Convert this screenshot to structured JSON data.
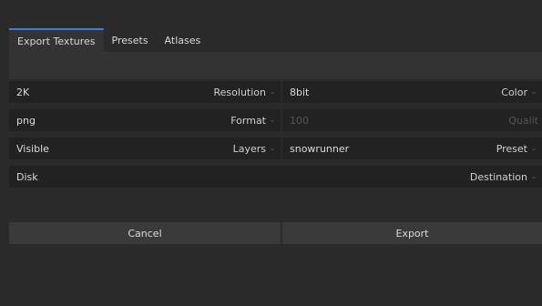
{
  "tabs": [
    {
      "label": "Export Textures",
      "active": true
    },
    {
      "label": "Presets",
      "active": false
    },
    {
      "label": "Atlases",
      "active": false
    }
  ],
  "settings": {
    "resolution": {
      "value": "2K",
      "label": "Resolution"
    },
    "color": {
      "value": "8bit",
      "label": "Color"
    },
    "format": {
      "value": "png",
      "label": "Format"
    },
    "quality": {
      "value": "100",
      "label": "Qualit",
      "disabled": true
    },
    "layers": {
      "value": "Visible",
      "label": "Layers"
    },
    "preset": {
      "value": "snowrunner",
      "label": "Preset"
    },
    "destination": {
      "value": "Disk",
      "label": "Destination"
    }
  },
  "caret": "⌄",
  "buttons": {
    "cancel": "Cancel",
    "export": "Export"
  },
  "colors": {
    "accent": "#3b7dd8",
    "background": "#2a2a2a",
    "field": "#222222",
    "button": "#3a3a3a"
  }
}
